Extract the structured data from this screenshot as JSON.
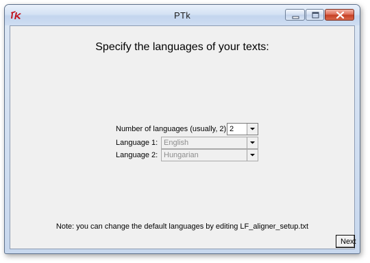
{
  "window": {
    "title": "PTk",
    "controls": {
      "minimize": "minimize-icon",
      "maximize": "maximize-icon",
      "close": "close-icon"
    }
  },
  "main": {
    "heading": "Specify the languages of your texts:",
    "fields": {
      "count_label": "Number of languages (usually, 2):",
      "count_value": "2",
      "lang1_label": "Language 1:",
      "lang1_value": "English",
      "lang2_label": "Language 2:",
      "lang2_value": "Hungarian"
    },
    "note": "Note: you can change the default languages by editing LF_aligner_setup.txt",
    "next_label": "Next"
  }
}
